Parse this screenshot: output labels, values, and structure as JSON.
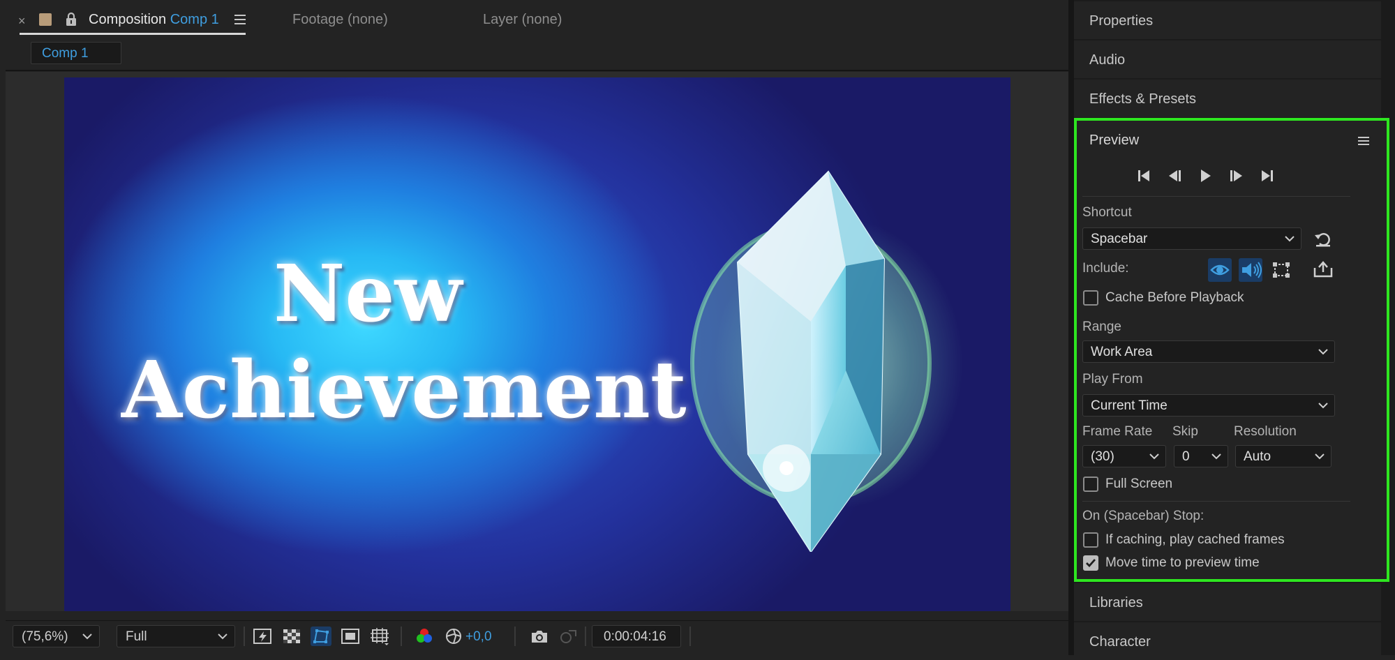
{
  "viewer": {
    "tabs": {
      "close_glyph": "×",
      "composition_label": "Composition",
      "composition_name": "Comp 1",
      "footage_label": "Footage (none)",
      "layer_label": "Layer (none)"
    },
    "comp_chip": "Comp 1",
    "canvas": {
      "line1": "New",
      "line2": "Achievement"
    },
    "toolbar": {
      "zoom": "(75,6%)",
      "resolution": "Full",
      "exposure": "+0,0",
      "timecode": "0:00:04:16"
    }
  },
  "panels": {
    "properties": "Properties",
    "audio": "Audio",
    "effects_presets": "Effects & Presets",
    "libraries": "Libraries",
    "character": "Character"
  },
  "preview": {
    "title": "Preview",
    "shortcut_label": "Shortcut",
    "shortcut_value": "Spacebar",
    "include_label": "Include:",
    "cache_before_playback": "Cache Before Playback",
    "cache_before_playback_checked": false,
    "range_label": "Range",
    "range_value": "Work Area",
    "play_from_label": "Play From",
    "play_from_value": "Current Time",
    "frame_rate_label": "Frame Rate",
    "frame_rate_value": "(30)",
    "skip_label": "Skip",
    "skip_value": "0",
    "resolution_label": "Resolution",
    "resolution_value": "Auto",
    "full_screen": "Full Screen",
    "full_screen_checked": false,
    "on_stop_label": "On (Spacebar) Stop:",
    "if_caching": "If caching, play cached frames",
    "if_caching_checked": false,
    "move_time": "Move time to preview time",
    "move_time_checked": true,
    "highlight_color": "#2ee620",
    "accent_color": "#3f9ee0"
  }
}
